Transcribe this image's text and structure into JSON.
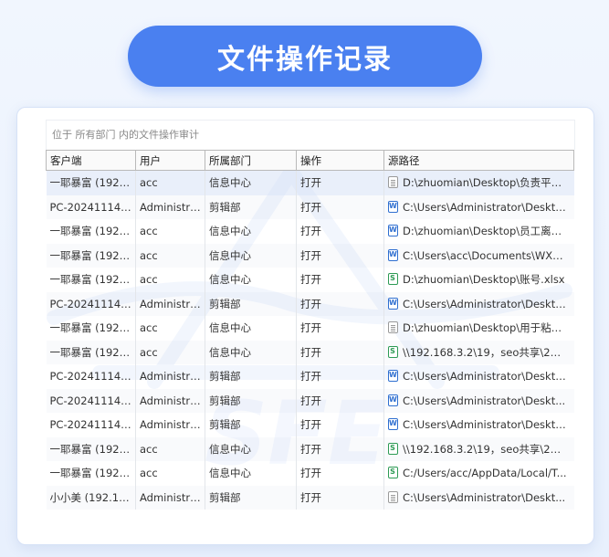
{
  "title": "文件操作记录",
  "scope_text": "位于 所有部门 内的文件操作审计",
  "columns": [
    "客户端",
    "用户",
    "所属部门",
    "操作",
    "源路径"
  ],
  "rows": [
    {
      "client": "一耶暴富 (192.1...",
      "user": "acc",
      "dept": "信息中心",
      "action": "打开",
      "icon": "text",
      "path": "D:\\zhuomian\\Desktop\\负责平台..."
    },
    {
      "client": "PC-202411141...",
      "user": "Administra...",
      "dept": "剪辑部",
      "action": "打开",
      "icon": "word",
      "path": "C:\\Users\\Administrator\\Deskto..."
    },
    {
      "client": "一耶暴富 (192.1...",
      "user": "acc",
      "dept": "信息中心",
      "action": "打开",
      "icon": "word",
      "path": "D:\\zhuomian\\Desktop\\员工离职..."
    },
    {
      "client": "一耶暴富 (192.1...",
      "user": "acc",
      "dept": "信息中心",
      "action": "打开",
      "icon": "word",
      "path": "C:\\Users\\acc\\Documents\\WXW..."
    },
    {
      "client": "一耶暴富 (192.1...",
      "user": "acc",
      "dept": "信息中心",
      "action": "打开",
      "icon": "excel",
      "path": "D:\\zhuomian\\Desktop\\账号.xlsx"
    },
    {
      "client": "PC-202411141...",
      "user": "Administra...",
      "dept": "剪辑部",
      "action": "打开",
      "icon": "word",
      "path": "C:\\Users\\Administrator\\Deskto..."
    },
    {
      "client": "一耶暴富 (192.1...",
      "user": "acc",
      "dept": "信息中心",
      "action": "打开",
      "icon": "text",
      "path": "D:\\zhuomian\\Desktop\\用于粘贴..."
    },
    {
      "client": "一耶暴富 (192.1...",
      "user": "acc",
      "dept": "信息中心",
      "action": "打开",
      "icon": "excel",
      "path": "\\\\192.168.3.2\\19，seo共享\\2、..."
    },
    {
      "client": "PC-202411141...",
      "user": "Administra...",
      "dept": "剪辑部",
      "action": "打开",
      "icon": "word",
      "path": "C:\\Users\\Administrator\\Deskto..."
    },
    {
      "client": "PC-202411141...",
      "user": "Administra...",
      "dept": "剪辑部",
      "action": "打开",
      "icon": "word",
      "path": "C:\\Users\\Administrator\\Deskt..."
    },
    {
      "client": "PC-202411141...",
      "user": "Administra...",
      "dept": "剪辑部",
      "action": "打开",
      "icon": "word",
      "path": "C:\\Users\\Administrator\\Deskto..."
    },
    {
      "client": "一耶暴富 (192.1...",
      "user": "acc",
      "dept": "信息中心",
      "action": "打开",
      "icon": "excel",
      "path": "\\\\192.168.3.2\\19，seo共享\\2、..."
    },
    {
      "client": "一耶暴富 (192.1...",
      "user": "acc",
      "dept": "信息中心",
      "action": "打开",
      "icon": "excel",
      "path": "C:/Users/acc/AppData/Local/T..."
    },
    {
      "client": "小小美 (192.16...",
      "user": "Administra...",
      "dept": "剪辑部",
      "action": "打开",
      "icon": "text",
      "path": "C:\\Users\\Administrator\\Deskt..."
    }
  ],
  "selected_row": 0,
  "colors": {
    "accent": "#4a80f0",
    "word": "#2f6fd0",
    "excel": "#2e9b55"
  }
}
